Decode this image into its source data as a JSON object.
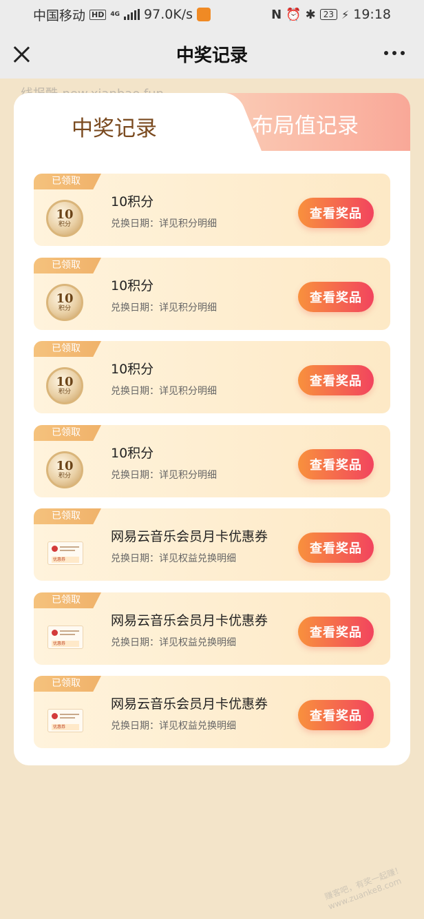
{
  "status_bar": {
    "carrier": "中国移动",
    "hd_label": "HD",
    "net_label": "4G",
    "speed": "97.0K/s",
    "battery": "23",
    "time": "19:18"
  },
  "nav": {
    "title": "中奖记录"
  },
  "watermark": "线报酷-new.xianbao.fun",
  "watermark_bottom": "赚客吧，有奖一起赚！ www.zuanke8.com",
  "tabs": {
    "active": "中奖记录",
    "inactive": "布局值记录"
  },
  "records": [
    {
      "badge": "已领取",
      "title": "10积分",
      "subtitle": "兑换日期：详见积分明细",
      "button": "查看奖品",
      "icon": "points-coin-icon",
      "coin_num": "10",
      "coin_unit": "积分"
    },
    {
      "badge": "已领取",
      "title": "10积分",
      "subtitle": "兑换日期：详见积分明细",
      "button": "查看奖品",
      "icon": "points-coin-icon",
      "coin_num": "10",
      "coin_unit": "积分"
    },
    {
      "badge": "已领取",
      "title": "10积分",
      "subtitle": "兑换日期：详见积分明细",
      "button": "查看奖品",
      "icon": "points-coin-icon",
      "coin_num": "10",
      "coin_unit": "积分"
    },
    {
      "badge": "已领取",
      "title": "10积分",
      "subtitle": "兑换日期：详见积分明细",
      "button": "查看奖品",
      "icon": "points-coin-icon",
      "coin_num": "10",
      "coin_unit": "积分"
    },
    {
      "badge": "已领取",
      "title": "网易云音乐会员月卡优惠券",
      "subtitle": "兑换日期：详见权益兑换明细",
      "button": "查看奖品",
      "icon": "voucher-icon",
      "voucher_tag": "优惠券"
    },
    {
      "badge": "已领取",
      "title": "网易云音乐会员月卡优惠券",
      "subtitle": "兑换日期：详见权益兑换明细",
      "button": "查看奖品",
      "icon": "voucher-icon",
      "voucher_tag": "优惠券"
    },
    {
      "badge": "已领取",
      "title": "网易云音乐会员月卡优惠券",
      "subtitle": "兑换日期：详见权益兑换明细",
      "button": "查看奖品",
      "icon": "voucher-icon",
      "voucher_tag": "优惠券"
    }
  ],
  "colors": {
    "page_bg": "#f3e4c9",
    "button_start": "#f8913d",
    "button_end": "#f2445e",
    "active_tab_text": "#7a4a1f"
  }
}
